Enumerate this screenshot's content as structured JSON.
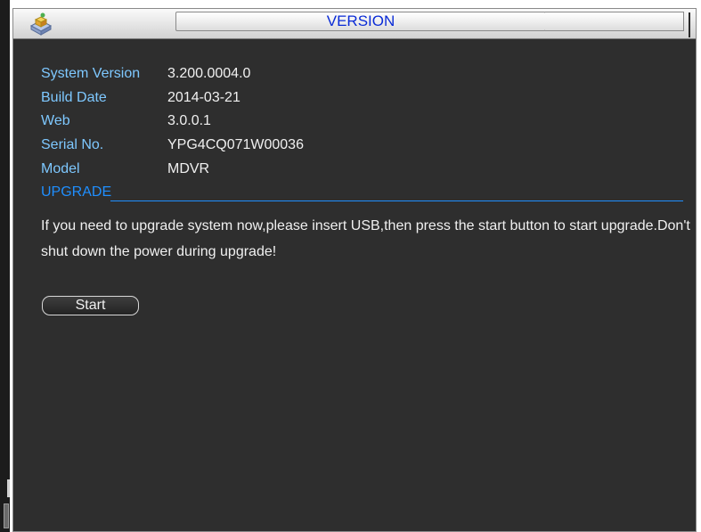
{
  "window": {
    "title": "VERSION"
  },
  "info": [
    {
      "label": "System Version",
      "value": "3.200.0004.0"
    },
    {
      "label": "Build Date",
      "value": "2014-03-21"
    },
    {
      "label": "Web",
      "value": "3.0.0.1"
    },
    {
      "label": "Serial No.",
      "value": "YPG4CQ071W00036"
    },
    {
      "label": "Model",
      "value": "MDVR"
    }
  ],
  "upgrade": {
    "heading": "UPGRADE",
    "message": "If you need to upgrade system now,please insert USB,then press the start button to start upgrade.Don't shut down the power during upgrade!",
    "start_label": "Start"
  },
  "icons": {
    "title_icon": "info-box-icon"
  },
  "colors": {
    "label": "#7ec8ff",
    "section_heading": "#1f8fff",
    "title": "#0a2bd6",
    "panel_background": "#2e2e2e"
  }
}
